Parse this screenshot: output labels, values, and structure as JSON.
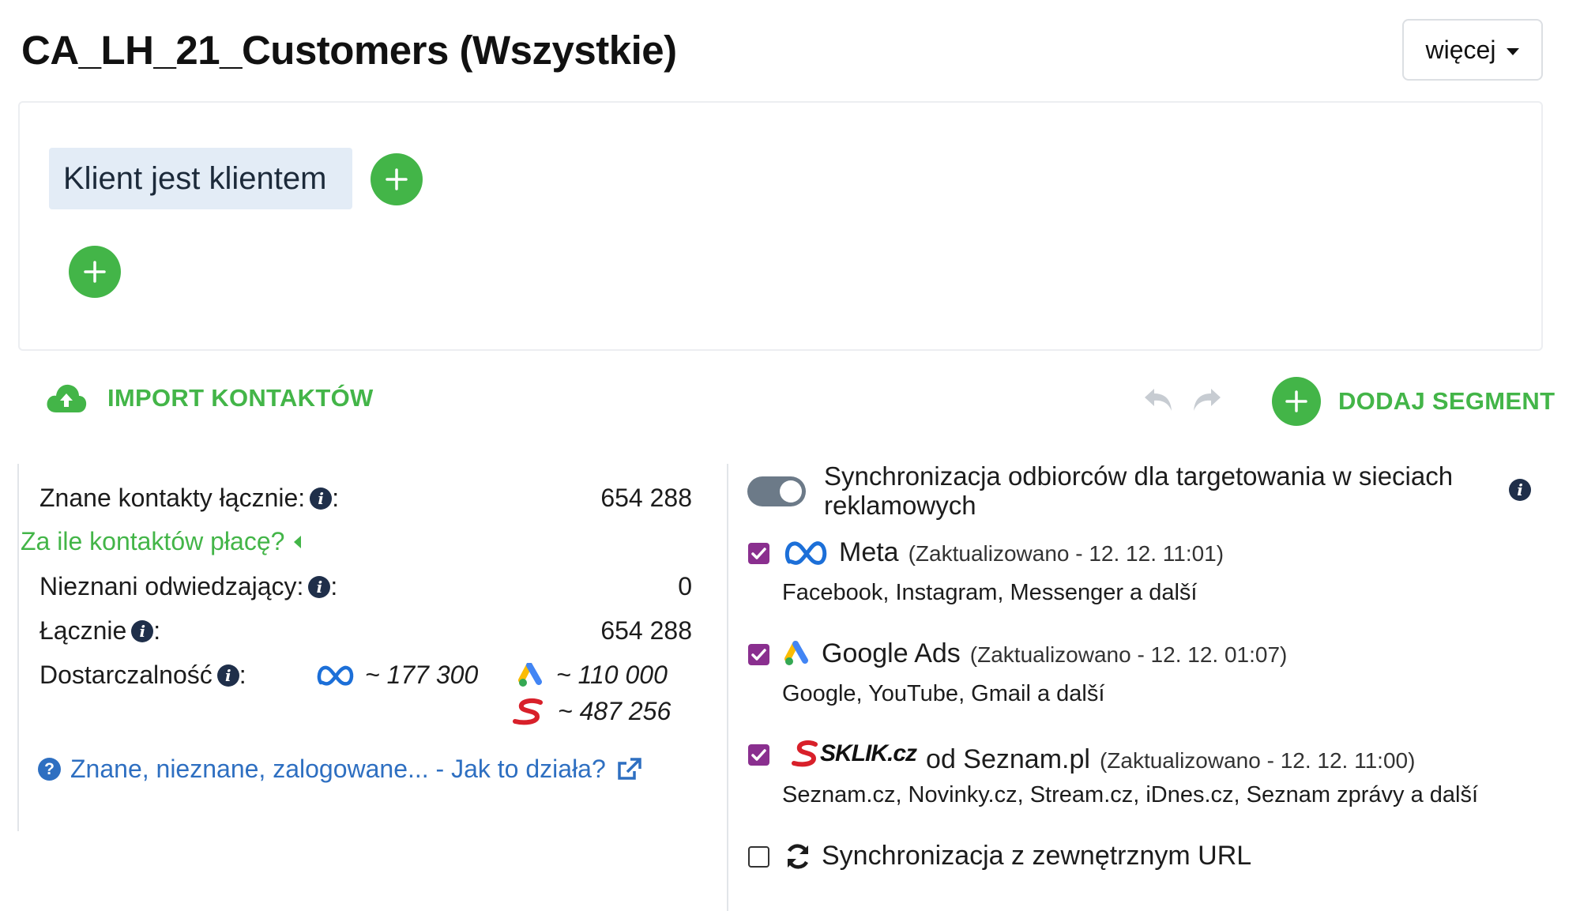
{
  "header": {
    "title": "CA_LH_21_Customers (Wszystkie)",
    "more_label": "więcej"
  },
  "segment": {
    "condition_label": "Klient jest klientem"
  },
  "actions": {
    "import_label": "IMPORT KONTAKTÓW",
    "add_segment_label": "DODAJ SEGMENT"
  },
  "stats": {
    "known_label": "Znane kontakty łącznie:",
    "known_value": "654 288",
    "pay_link": "Za ile kontaktów płacę?",
    "unknown_label": "Nieznani odwiedzający:",
    "unknown_value": "0",
    "total_label": "Łącznie",
    "total_value": "654 288",
    "deliverability_label": "Dostarczalność",
    "colon": ":",
    "deliverability": {
      "meta": "~ 177 300",
      "google": "~ 110 000",
      "sklik": "~ 487 256"
    },
    "help_link": "Znane, nieznane, zalogowane... - Jak to działa?"
  },
  "sync": {
    "title": "Synchronizacja odbiorców dla targetowania w sieciach reklamowych",
    "enabled": true,
    "networks": [
      {
        "name": "Meta",
        "updated": "(Zaktualizowano - 12. 12. 11:01)",
        "desc": "Facebook, Instagram, Messenger a další",
        "checked": true
      },
      {
        "name": "Google Ads",
        "updated": "(Zaktualizowano - 12. 12. 01:07)",
        "desc": "Google, YouTube, Gmail a další",
        "checked": true
      },
      {
        "name": "od Seznam.pl",
        "logo_text": "SKLIK.cz",
        "updated": "(Zaktualizowano - 12. 12. 11:00)",
        "desc": "Seznam.cz, Novinky.cz, Stream.cz, iDnes.cz, Seznam zprávy a další",
        "checked": true
      }
    ],
    "external_url_label": "Synchronizacja z zewnętrznym URL",
    "external_url_checked": false
  },
  "colors": {
    "accent_green": "#43b548",
    "checkbox_purple": "#8a2f8f",
    "link_blue": "#2e6fc1"
  }
}
